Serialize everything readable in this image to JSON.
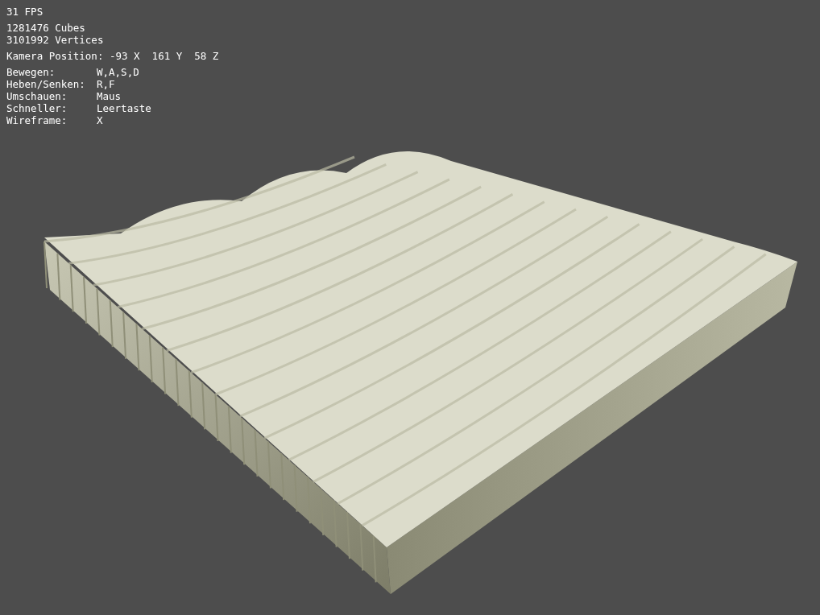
{
  "hud": {
    "fps": "31 FPS",
    "stats": [
      "1281476 Cubes",
      "3101992 Vertices"
    ],
    "camera": "Kamera Position: -93 X  161 Y  58 Z",
    "controls": [
      {
        "action": "Bewegen:",
        "key": "W,A,S,D"
      },
      {
        "action": "Heben/Senken:",
        "key": "R,F"
      },
      {
        "action": "Umschauen:",
        "key": "Maus"
      },
      {
        "action": "Schneller:",
        "key": "Leertaste"
      },
      {
        "action": "Wireframe:",
        "key": "X"
      }
    ]
  }
}
